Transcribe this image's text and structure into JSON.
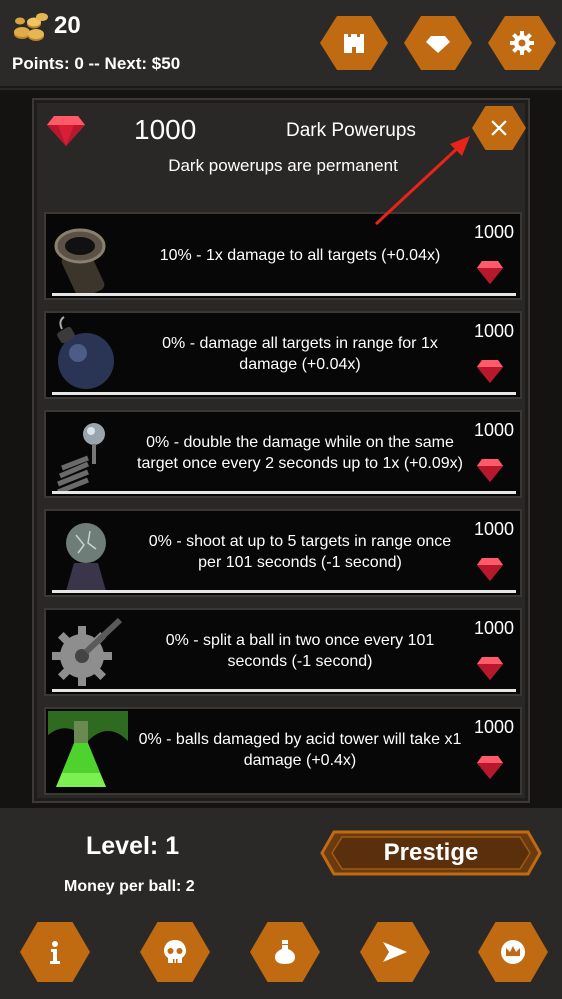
{
  "header": {
    "coins": "20",
    "points_text": "Points: 0 -- Next: $50",
    "buttons": [
      {
        "name": "castle-button",
        "icon": "castle-icon"
      },
      {
        "name": "gem-shop-button",
        "icon": "diamond-icon"
      },
      {
        "name": "settings-button",
        "icon": "gear-icon"
      }
    ]
  },
  "modal": {
    "gem_count": "1000",
    "title": "Dark Powerups",
    "subtitle": "Dark powerups are permanent",
    "close_icon": "close-icon"
  },
  "powerups": [
    {
      "description": "10% - 1x damage to all targets (+0.04x)",
      "cost": "1000",
      "icon": "cannon-icon"
    },
    {
      "description": "0% - damage all targets in range for 1x damage (+0.04x)",
      "cost": "1000",
      "icon": "bomb-icon"
    },
    {
      "description": "0% - double the damage while on the same target once every 2 seconds up to 1x  (+0.09x)",
      "cost": "1000",
      "icon": "spring-icon"
    },
    {
      "description": "0% - shoot at up to 5 targets in range once per 101 seconds (-1 second)",
      "cost": "1000",
      "icon": "plasma-orb-icon"
    },
    {
      "description": "0% - split a ball in two once every 101 seconds (-1 second)",
      "cost": "1000",
      "icon": "saw-blade-icon"
    },
    {
      "description": "0% - balls damaged by acid tower will take x1 damage (+0.4x)",
      "cost": "1000",
      "icon": "acid-flask-icon"
    }
  ],
  "footer": {
    "level_text": "Level: 1",
    "money_text": "Money per ball: 2",
    "prestige_label": "Prestige",
    "nav": [
      {
        "name": "info-button",
        "icon": "info-icon"
      },
      {
        "name": "skull-button",
        "icon": "skull-icon"
      },
      {
        "name": "potion-button",
        "icon": "potion-icon"
      },
      {
        "name": "send-button",
        "icon": "paper-plane-icon"
      },
      {
        "name": "crown-button",
        "icon": "crown-icon"
      }
    ]
  },
  "colors": {
    "accent": "#c06a12",
    "gem": "#e0243a",
    "panel": "#2a2826",
    "card": "#070707"
  }
}
